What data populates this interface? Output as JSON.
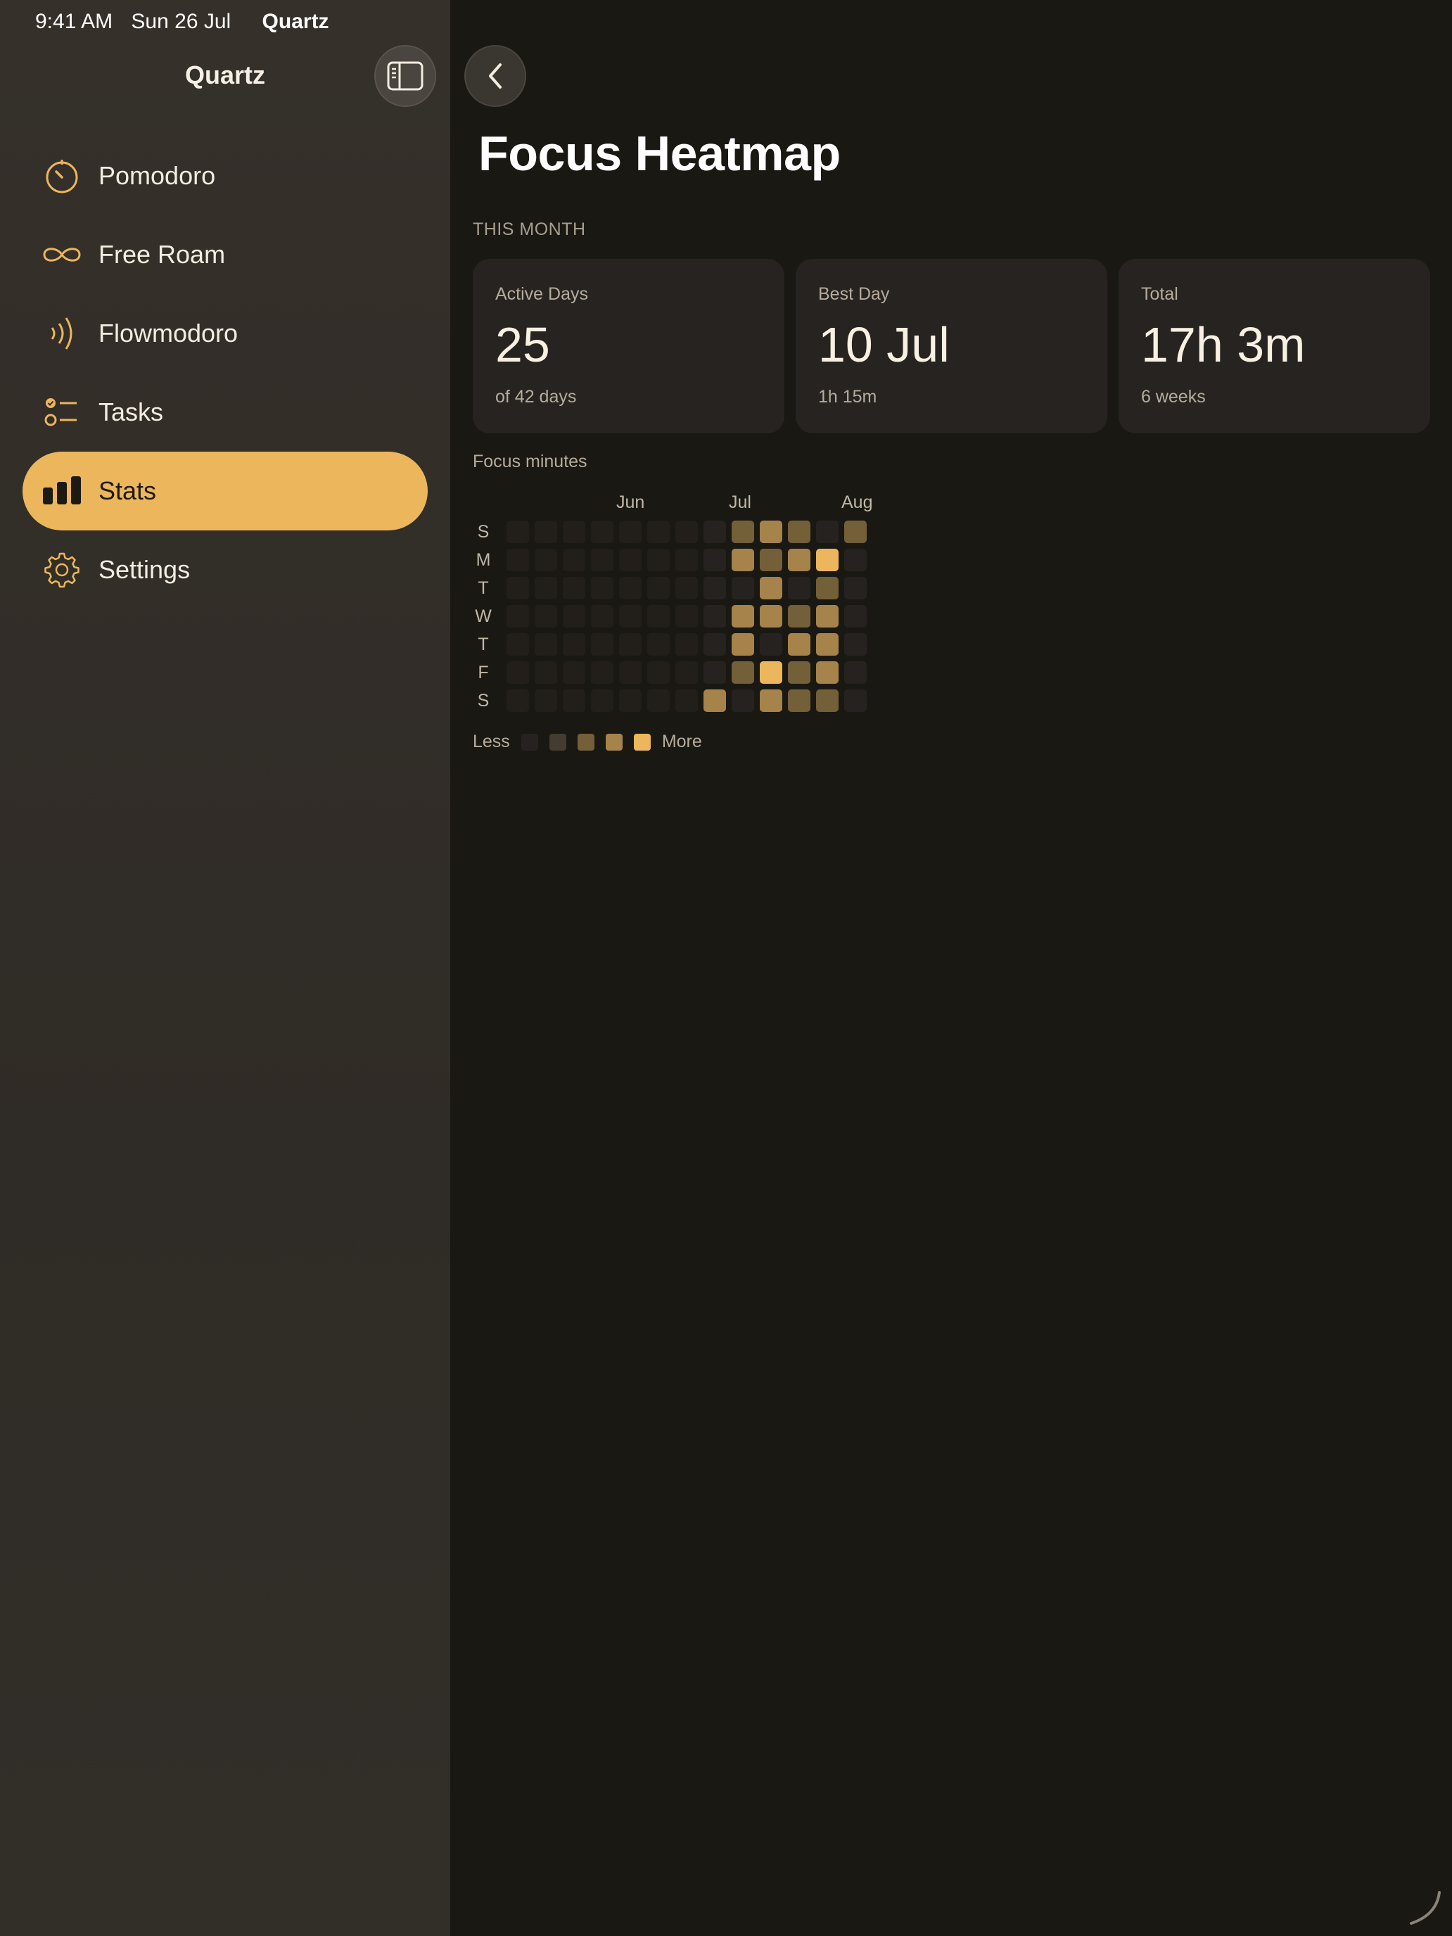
{
  "status_bar": {
    "time": "9:41 AM",
    "date": "Sun 26 Jul",
    "app": "Quartz",
    "icons": [
      "signal-icon",
      "wifi-icon",
      "battery-charging-icon"
    ]
  },
  "sidebar": {
    "title": "Quartz",
    "items": [
      {
        "label": "Pomodoro",
        "icon": "timer-icon",
        "active": false
      },
      {
        "label": "Free Roam",
        "icon": "infinity-icon",
        "active": false
      },
      {
        "label": "Flowmodoro",
        "icon": "waves-icon",
        "active": false
      },
      {
        "label": "Tasks",
        "icon": "checklist-icon",
        "active": false
      },
      {
        "label": "Stats",
        "icon": "bar-chart-icon",
        "active": true
      },
      {
        "label": "Settings",
        "icon": "gear-icon",
        "active": false
      }
    ]
  },
  "main": {
    "title": "Focus Heatmap",
    "section": "THIS MONTH",
    "cards": [
      {
        "label": "Active Days",
        "value": "25",
        "sub": "of 42 days"
      },
      {
        "label": "Best Day",
        "value": "10 Jul",
        "sub": "1h 15m"
      },
      {
        "label": "Total",
        "value": "17h 3m",
        "sub": "6 weeks"
      }
    ],
    "focus_label": "Focus minutes",
    "legend": {
      "less": "Less",
      "more": "More"
    }
  },
  "colors": {
    "accent": "#ecb65c",
    "levels": [
      "#262220",
      "#433c2f",
      "#735f38",
      "#a5834a",
      "#ecb65c"
    ],
    "empty": "#221f1b"
  },
  "chart_data": {
    "type": "heatmap",
    "title": "",
    "months": [
      {
        "label": "Jun",
        "col": 4
      },
      {
        "label": "Jul",
        "col": 8
      },
      {
        "label": "Aug",
        "col": 12
      }
    ],
    "days": [
      "S",
      "M",
      "T",
      "W",
      "T",
      "F",
      "S"
    ],
    "weeks": 13,
    "levels": [
      [
        -1,
        -1,
        -1,
        -1,
        -1,
        -1,
        -1,
        0,
        2,
        3,
        2,
        0,
        2
      ],
      [
        -1,
        -1,
        -1,
        -1,
        -1,
        -1,
        -1,
        0,
        3,
        2,
        3,
        4,
        0
      ],
      [
        -1,
        -1,
        -1,
        -1,
        -1,
        -1,
        -1,
        0,
        0,
        3,
        0,
        2,
        0
      ],
      [
        -1,
        -1,
        -1,
        -1,
        -1,
        -1,
        -1,
        0,
        3,
        3,
        2,
        3,
        0
      ],
      [
        -1,
        -1,
        -1,
        -1,
        -1,
        -1,
        -1,
        0,
        3,
        0,
        3,
        3,
        0
      ],
      [
        -1,
        -1,
        -1,
        -1,
        -1,
        -1,
        -1,
        0,
        2,
        4,
        2,
        3,
        0
      ],
      [
        -1,
        -1,
        -1,
        -1,
        -1,
        -1,
        -1,
        3,
        0,
        3,
        2,
        2,
        0
      ]
    ]
  }
}
